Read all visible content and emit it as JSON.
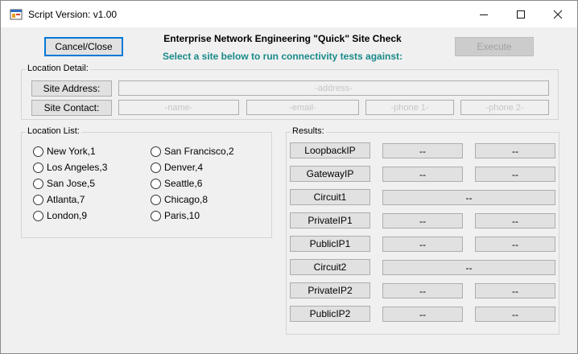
{
  "window": {
    "title": "Script Version:  v1.00",
    "icon": "winforms-app-icon",
    "controls": {
      "minimize": "minimize-icon",
      "maximize": "maximize-icon",
      "close": "close-icon"
    }
  },
  "toolbar": {
    "cancel_label": "Cancel/Close",
    "execute_label": "Execute"
  },
  "header": {
    "title": "Enterprise Network Engineering \"Quick\" Site Check",
    "subtitle": "Select a site below to run connectivity tests against:"
  },
  "location_detail": {
    "label": "Location Detail:",
    "site_address_label": "Site Address:",
    "site_contact_label": "Site Contact:",
    "address_placeholder": "-address-",
    "name_placeholder": "-name-",
    "email_placeholder": "-email-",
    "phone1_placeholder": "-phone 1-",
    "phone2_placeholder": "-phone 2-"
  },
  "location_list": {
    "label": "Location List:",
    "items": [
      "New York,1",
      "San Francisco,2",
      "Los Angeles,3",
      "Denver,4",
      "San Jose,5",
      "Seattle,6",
      "Atlanta,7",
      "Chicago,8",
      "London,9",
      "Paris,10"
    ]
  },
  "results": {
    "label": "Results:",
    "rows": [
      {
        "label": "LoopbackIP",
        "values": [
          "--",
          "--"
        ]
      },
      {
        "label": "GatewayIP",
        "values": [
          "--",
          "--"
        ]
      },
      {
        "label": "Circuit1",
        "values": [
          "--"
        ]
      },
      {
        "label": "PrivateIP1",
        "values": [
          "--",
          "--"
        ]
      },
      {
        "label": "PublicIP1",
        "values": [
          "--",
          "--"
        ]
      },
      {
        "label": "Circuit2",
        "values": [
          "--"
        ]
      },
      {
        "label": "PrivateIP2",
        "values": [
          "--",
          "--"
        ]
      },
      {
        "label": "PublicIP2",
        "values": [
          "--",
          "--"
        ]
      }
    ]
  },
  "colors": {
    "subtitle": "#1a8a8a",
    "default_button_border": "#0078d7",
    "placeholder_text": "#c6c6c6"
  }
}
